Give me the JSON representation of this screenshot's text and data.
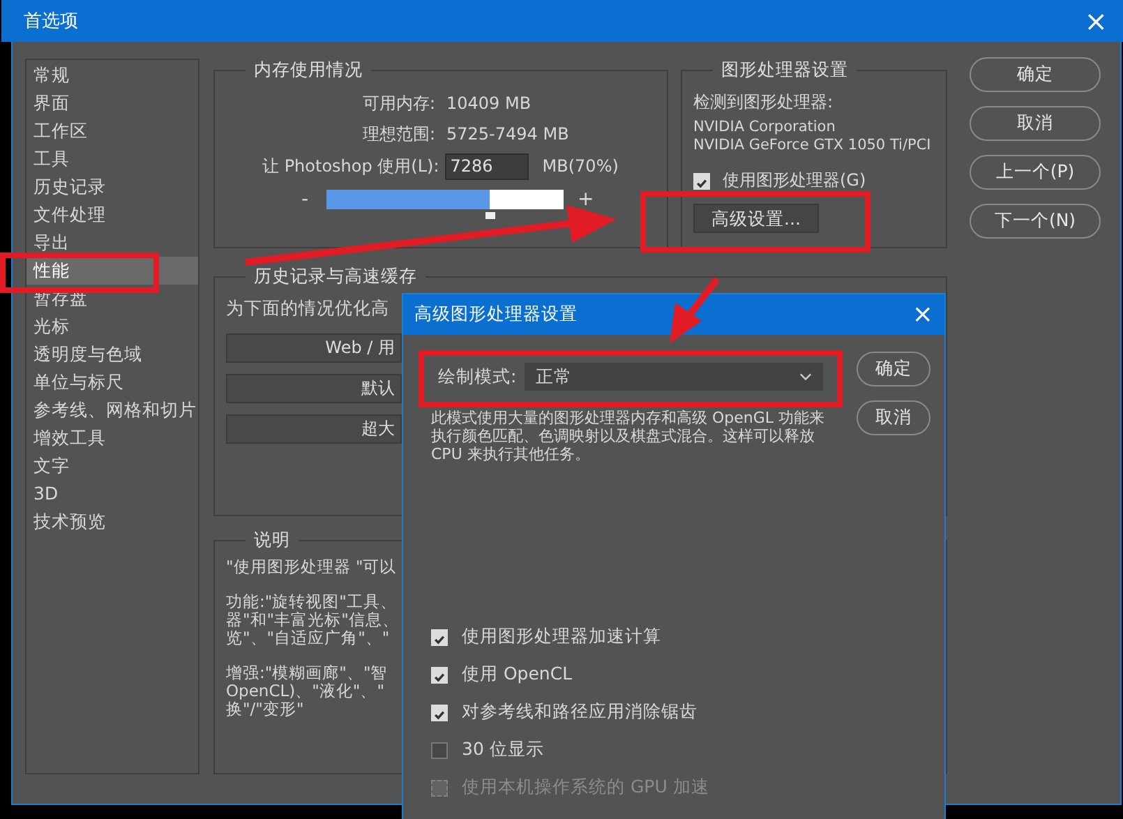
{
  "window": {
    "title": "首选项",
    "close": "×"
  },
  "sidebar": {
    "items": [
      {
        "label": "常规",
        "selected": false
      },
      {
        "label": "界面",
        "selected": false
      },
      {
        "label": "工作区",
        "selected": false
      },
      {
        "label": "工具",
        "selected": false
      },
      {
        "label": "历史记录",
        "selected": false
      },
      {
        "label": "文件处理",
        "selected": false
      },
      {
        "label": "导出",
        "selected": false
      },
      {
        "label": "性能",
        "selected": true
      },
      {
        "label": "暂存盘",
        "selected": false
      },
      {
        "label": "光标",
        "selected": false
      },
      {
        "label": "透明度与色域",
        "selected": false
      },
      {
        "label": "单位与标尺",
        "selected": false
      },
      {
        "label": "参考线、网格和切片",
        "selected": false
      },
      {
        "label": "增效工具",
        "selected": false
      },
      {
        "label": "文字",
        "selected": false
      },
      {
        "label": "3D",
        "selected": false
      },
      {
        "label": "技术预览",
        "selected": false
      }
    ]
  },
  "memory": {
    "title": "内存使用情况",
    "available_label": "可用内存:",
    "available": "10409 MB",
    "ideal_label": "理想范围:",
    "ideal": "5725-7494 MB",
    "use_label": "让 Photoshop 使用(L):",
    "use_value": "7286",
    "use_unit": "MB(70%)",
    "minus": "-",
    "plus": "+",
    "level": 0.69
  },
  "gpu": {
    "title": "图形处理器设置",
    "detected_label": "检测到图形处理器:",
    "vendor": "NVIDIA Corporation",
    "model": "NVIDIA GeForce GTX 1050 Ti/PCI",
    "use_gpu": {
      "label": "使用图形处理器(G)",
      "checked": true
    },
    "advanced_button": "高级设置..."
  },
  "buttons": [
    "确定",
    "取消",
    "上一个(P)",
    "下一个(N)"
  ],
  "history": {
    "title": "历史记录与高速缓存",
    "optimize_label": "为下面的情况优化高",
    "presets": [
      "Web / 用",
      "默认",
      "超大"
    ]
  },
  "description": {
    "title": "说明",
    "paragraphs": [
      [
        "\"使用图形处理器 \"可以"
      ],
      [
        "功能:\"旋转视图\"工具、",
        "器\"和\"丰富光标\"信息、",
        "览\"、\"自适应广角\"、\""
      ],
      [
        "增强:\"模糊画廊\"、\"智",
        "OpenCL)、\"液化\"、\"",
        "换\"/\"变形\""
      ]
    ]
  },
  "advanced_dialog": {
    "title": "高级图形处理器设置",
    "close": "×",
    "mode_label": "绘制模式:",
    "mode_value": "正常",
    "ok": "确定",
    "cancel": "取消",
    "mode_description": "此模式使用大量的图形处理器内存和高级 OpenGL 功能来执行颜色匹配、色调映射以及棋盘式混合。这样可以释放 CPU 来执行其他任务。",
    "options": [
      {
        "label": "使用图形处理器加速计算",
        "checked": true,
        "disabled": false
      },
      {
        "label": "使用 OpenCL",
        "checked": true,
        "disabled": false
      },
      {
        "label": "对参考线和路径应用消除锯齿",
        "checked": true,
        "disabled": false
      },
      {
        "label": "30 位显示",
        "checked": false,
        "disabled": false
      },
      {
        "label": "使用本机操作系统的 GPU 加速",
        "checked": false,
        "disabled": true
      }
    ]
  }
}
